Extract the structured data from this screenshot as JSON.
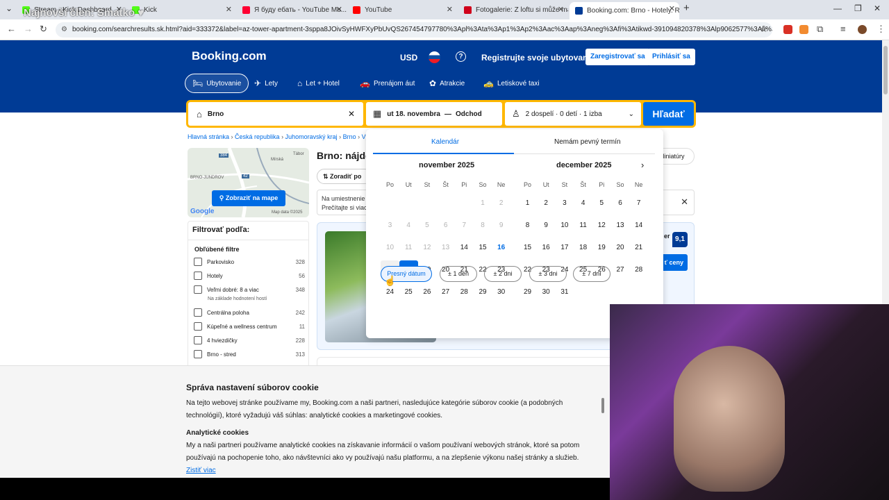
{
  "browser": {
    "tabs": [
      {
        "label": "Stream - Kick Dashboard",
        "color": "#53fc18"
      },
      {
        "label": "Kick",
        "color": "#53fc18"
      },
      {
        "label": "Я буду ебать - YouTube Mu...",
        "color": "#ff0033"
      },
      {
        "label": "YouTube",
        "color": "#ff0000"
      },
      {
        "label": "Fotogalerie: Z loftu si může ma...",
        "color": "#d0021b"
      },
      {
        "label": "Booking.com: Brno - Hotely. Re...",
        "color": "#003b95"
      }
    ],
    "new_tab": "+",
    "url": "booking.com/searchresults.sk.html?aid=333372&label=az-tower-apartment-3sppa8JOivSyHWFXyPbUvQS267454797780%3Apl%3Ata%3Ap1%3Ap2%3Aac%3Aap%3Aneg%3Afi%3Atikwd-391094820378%3Alp9062577%3Ali%3Adec%3Ad...",
    "stream_overlay": "Najnovší člen: Smatko ♥"
  },
  "header": {
    "logo": "Booking.com",
    "currency": "USD",
    "help": "?",
    "register_property": "Registrujte svoje ubytovanie",
    "sign_up": "Zaregistrovať sa",
    "sign_in": "Prihlásiť sa",
    "nav": [
      {
        "label": "Ubytovanie",
        "icon": "bed-icon",
        "glyph": "🛏"
      },
      {
        "label": "Lety",
        "icon": "plane-icon",
        "glyph": "✈"
      },
      {
        "label": "Let + Hotel",
        "icon": "flight-hotel-icon",
        "glyph": "⌂"
      },
      {
        "label": "Prenájom áut",
        "icon": "car-icon",
        "glyph": "🚗"
      },
      {
        "label": "Atrakcie",
        "icon": "attractions-icon",
        "glyph": "✿"
      },
      {
        "label": "Letiskové taxi",
        "icon": "taxi-icon",
        "glyph": "🚕"
      }
    ]
  },
  "search": {
    "destination": "Brno",
    "dates": "ut 18. novembra",
    "dates_sep": "—",
    "checkout_placeholder": "Odchod",
    "guests": "2 dospelí · 0 detí · 1 izba",
    "button": "Hľadať"
  },
  "breadcrumbs": [
    "Hlavná stránka",
    "Česká republika",
    "Juhomoravský kraj",
    "Brno",
    "Vý"
  ],
  "map": {
    "button": "Zobraziť na mape",
    "google": "Google",
    "credit": "Map data ©2025",
    "labels": [
      "BRNO-JUNDROV",
      "Mírská",
      "Tábor",
      "384",
      "42"
    ]
  },
  "filters": {
    "title": "Filtrovať podľa:",
    "section": "Obľúbené filtre",
    "items": [
      {
        "label": "Parkovisko",
        "count": "328"
      },
      {
        "label": "Hotely",
        "count": "56"
      },
      {
        "label": "Veľmi dobré: 8 a viac",
        "count": "348",
        "sub": "Na základe hodnotení hostí"
      },
      {
        "label": "Centrálna poloha",
        "count": "242"
      },
      {
        "label": "Kúpeľné a wellness centrum",
        "count": "11"
      },
      {
        "label": "4 hviezdičky",
        "count": "228"
      },
      {
        "label": "Brno - stred",
        "count": "313"
      }
    ]
  },
  "results": {
    "title": "Brno: nájde",
    "sort": "Zoradiť po",
    "notice_line1": "Na umiestnenie",
    "notice_line2": "Prečítajte si viac",
    "view_toggle": "Miniatúry",
    "card_score": "9,1",
    "card_rating_tail": "er",
    "card_button": "ť ceny"
  },
  "calendar": {
    "tab_calendar": "Kalendár",
    "tab_flexible": "Nemám pevný termín",
    "months": [
      {
        "title": "november 2025",
        "weekdays": [
          "Po",
          "Ut",
          "St",
          "Št",
          "Pi",
          "So",
          "Ne"
        ],
        "weeks": [
          [
            "",
            "",
            "",
            "",
            "",
            "1",
            "2"
          ],
          [
            "3",
            "4",
            "5",
            "6",
            "7",
            "8",
            "9"
          ],
          [
            "10",
            "11",
            "12",
            "13",
            "14",
            "15",
            "16"
          ],
          [
            "17",
            "18",
            "19",
            "20",
            "21",
            "22",
            "23"
          ],
          [
            "24",
            "25",
            "26",
            "27",
            "28",
            "29",
            "30"
          ]
        ]
      },
      {
        "title": "december 2025",
        "weekdays": [
          "Po",
          "Ut",
          "St",
          "Št",
          "Pi",
          "So",
          "Ne"
        ],
        "weeks": [
          [
            "1",
            "2",
            "3",
            "4",
            "5",
            "6",
            "7"
          ],
          [
            "8",
            "9",
            "10",
            "11",
            "12",
            "13",
            "14"
          ],
          [
            "15",
            "16",
            "17",
            "18",
            "19",
            "20",
            "21"
          ],
          [
            "22",
            "23",
            "24",
            "25",
            "26",
            "27",
            "28"
          ],
          [
            "29",
            "30",
            "31",
            "",
            "",
            "",
            ""
          ]
        ]
      }
    ],
    "disabled_nov_days": 13,
    "today": "16",
    "selected": "18",
    "hovered": "17",
    "flex_options": [
      "Presný dátum",
      "± 1 deň",
      "± 2 dni",
      "± 3 dni",
      "± 7 dní"
    ]
  },
  "cookie": {
    "title": "Správa nastavení súborov cookie",
    "intro": "Na tejto webovej stránke používame my, Booking.com a naši partneri, nasledujúce kategórie súborov cookie (a podobných technológií), ktoré vyžadujú váš súhlas: analytické cookies a marketingové cookies.",
    "subtitle": "Analytické cookies",
    "body": "My a naši partneri používame analytické cookies na získavanie informácií o vašom používaní webových stránok, ktoré sa potom používajú na pochopenie toho, ako návštevníci ako vy používajú našu platformu, a na zlepšenie výkonu našej stránky a služieb.",
    "link": "Zistiť viac"
  }
}
